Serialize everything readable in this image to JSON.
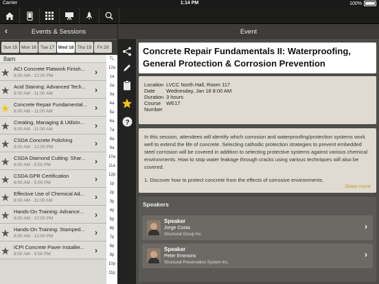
{
  "status": {
    "carrier": "Carrier",
    "time": "1:14 PM",
    "battery": "100%"
  },
  "topbar": {
    "icons": [
      "home-icon",
      "phone-icon",
      "grid-icon",
      "easel-icon",
      "rocket-icon",
      "search-icon"
    ]
  },
  "left": {
    "header": "Events & Sessions",
    "days": [
      "Sun 15",
      "Mon 16",
      "Tue 17",
      "Wed 18",
      "Thu 19",
      "Fri 20"
    ],
    "active_day": "Wed 18",
    "time_header": "8am",
    "sessions": [
      {
        "title": "ACI Concrete Flatwork Finish...",
        "time": "8:00 AM - 12:00 PM",
        "favorite": false
      },
      {
        "title": "Acid Staining: Advanced Tech...",
        "time": "8:00 AM - 11:00 AM",
        "favorite": false
      },
      {
        "title": "Concrete Repair Fundamental...",
        "time": "8:00 AM - 11:00 AM",
        "favorite": true
      },
      {
        "title": "Creating, Managing & Utilizin...",
        "time": "8:00 AM - 11:00 AM",
        "favorite": false
      },
      {
        "title": "CSDA Concrete Polishing",
        "time": "8:00 AM - 12:00 PM",
        "favorite": false
      },
      {
        "title": "CSDA Diamond Cutting: Shar...",
        "time": "8:00 AM - 5:00 PM",
        "favorite": false
      },
      {
        "title": "CSDA GPR Certification",
        "time": "8:00 AM - 5:00 PM",
        "favorite": false
      },
      {
        "title": "Effective Use of Chemical Ad...",
        "time": "8:00 AM - 11:00 AM",
        "favorite": false
      },
      {
        "title": "Hands-On Training: Advance...",
        "time": "8:00 AM - 12:00 PM",
        "favorite": false
      },
      {
        "title": "Hands-On Training: Stamped...",
        "time": "8:00 AM - 12:00 PM",
        "favorite": false
      },
      {
        "title": "ICPI Concrete Paver Installer...",
        "time": "8:00 AM - 5:00 PM",
        "favorite": false
      }
    ],
    "index": [
      "12a",
      "1a",
      "2a",
      "3a",
      "4a",
      "5a",
      "6a",
      "7a",
      "8a",
      "9a",
      "10a",
      "11a",
      "12p",
      "1p",
      "2p",
      "3p",
      "4p",
      "5p",
      "6p",
      "7p",
      "8p",
      "9p",
      "10p",
      "11p"
    ]
  },
  "right": {
    "header": "Event",
    "title": "Concrete Repair Fundamentals II: Waterproofing, General Protection & Corrosion Prevention",
    "info": {
      "location_label": "Location",
      "location": "LVCC North Hall, Room 117",
      "date_label": "Date",
      "date": "Wednesday, Jan 18 8:00 AM",
      "duration_label": "Duration",
      "duration": "3 hours",
      "course_label": "Course",
      "number_label": "Number",
      "course_number": "WE17"
    },
    "description": "In this session, attendees will identify which corrosion and waterproofing/protection systems work well to extend the life of concrete. Selecting cathodic protection strategies to prevent embedded steel corrosion will be covered in addition to selecting protective systems against various chemical environments. How to stop water leakage through cracks using various techniques will also be covered.",
    "description_2": "1. Discover how to protect concrete from the effects of corrosive environments.",
    "show_more": "Show more",
    "speakers_header": "Speakers",
    "speakers": [
      {
        "role": "Speaker",
        "name": "Jorge Costa",
        "org": "Structural Group Inc."
      },
      {
        "role": "Speaker",
        "name": "Peter Emmons",
        "org": "Structural Preservation System Inc."
      }
    ]
  },
  "tools": {
    "icons": [
      "share-icon",
      "pencil-icon",
      "clipboard-icon",
      "star-icon",
      "help-icon"
    ],
    "accent": "#f2c418"
  }
}
